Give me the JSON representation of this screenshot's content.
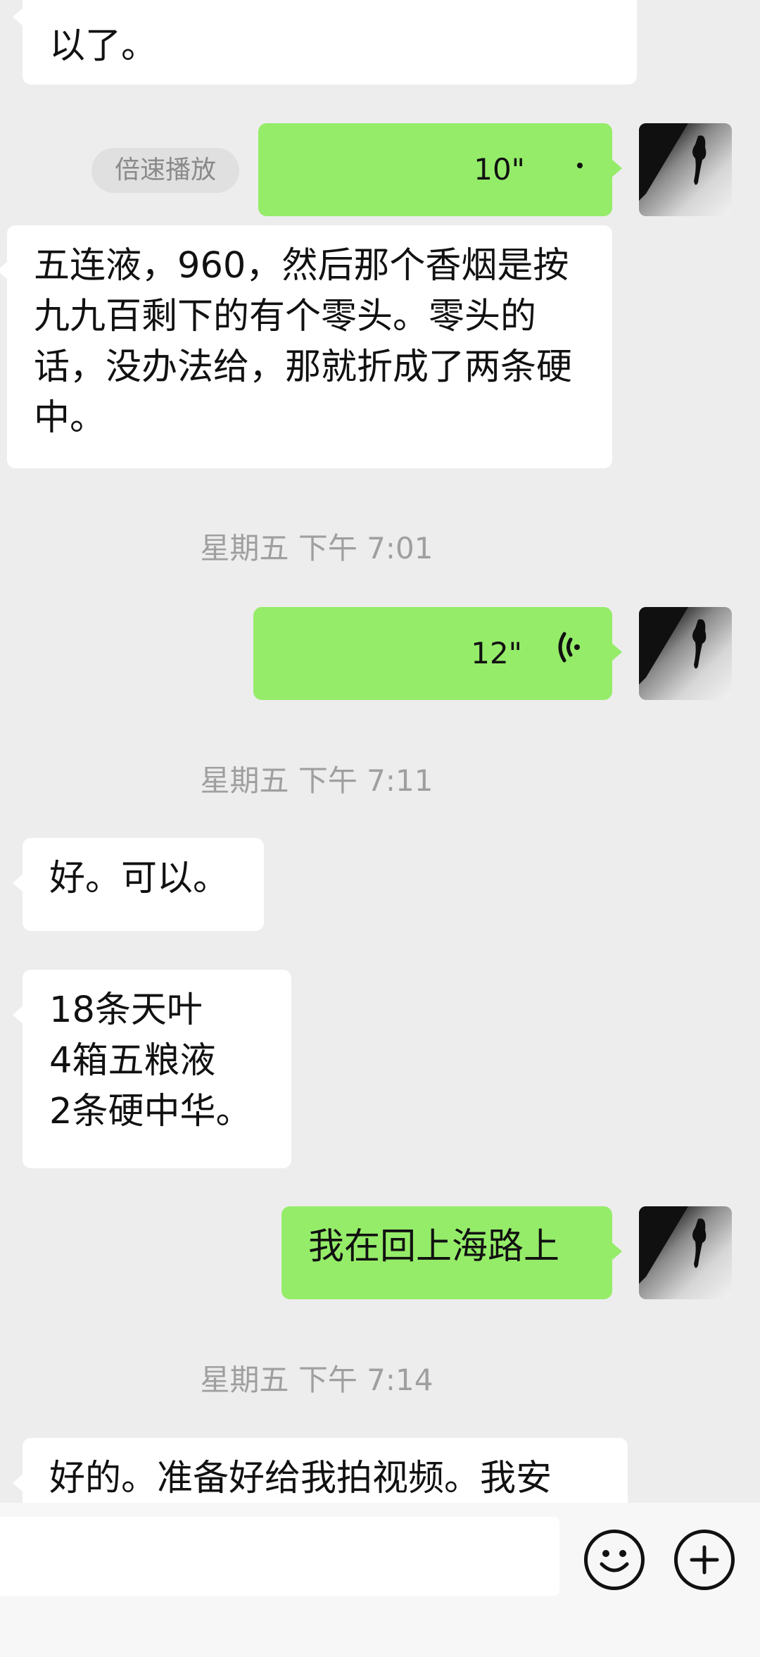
{
  "messages": {
    "top_partial_line": "以了。",
    "speed_play_label": "倍速播放",
    "voice1_duration": "10\"",
    "msg_liquor_text": "五连液，960，然后那个香烟是按九九百剩下的有个零头。零头的话，没办法给，那就折成了两条硬中。",
    "time1": "星期五 下午 7:01",
    "voice2_duration": "12\"",
    "time2": "星期五 下午 7:11",
    "msg_ok": "好。可以。",
    "list_line1": "18条天叶",
    "list_line2": "4箱五粮液",
    "list_line3": "2条硬中华。",
    "msg_on_way": "我在回上海路上",
    "time3": "星期五 下午 7:14",
    "msg_last_partial": "好的。准备好给我拍视频。我安"
  },
  "composer": {
    "input_value": "",
    "emoji_icon": "smile-face-icon",
    "plus_icon": "plus-circle-icon"
  },
  "colors": {
    "background": "#ededed",
    "incoming_bubble": "#ffffff",
    "outgoing_bubble": "#95ec69",
    "timestamp_text": "#9f9f9f"
  }
}
